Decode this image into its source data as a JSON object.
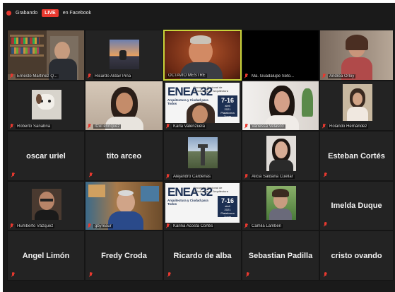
{
  "topbar": {
    "recording_label": "Grabando",
    "live_label": "LIVE",
    "platform_label": "en Facebook"
  },
  "colors": {
    "accent_active": "#c8d43a",
    "muted_mic": "#e8392f",
    "live_red": "#e8392f"
  },
  "poster": {
    "title": "ENEA 32",
    "subtitle": "Encuentro Nacional de Estudiantes de Arquitectura",
    "theme": "Arquitectura y Ciudad para Todos",
    "date_days": "7-16",
    "date_month": "abril",
    "date_year": "2021",
    "date_note": "Plataforma Zoom"
  },
  "participants": [
    {
      "name": "Ernesto Martínez Q...",
      "type": "video"
    },
    {
      "name": "Ricardo Aldair Piña",
      "type": "video"
    },
    {
      "name": "OCTAVIO MESTRE",
      "type": "video",
      "active": true
    },
    {
      "name": "Ma. Guadalupe Seto...",
      "type": "black"
    },
    {
      "name": "Andrea Orloy",
      "type": "video"
    },
    {
      "name": "Roberto Sanabria",
      "type": "video"
    },
    {
      "name": "itzel enriquez",
      "type": "video"
    },
    {
      "name": "Karla Valenzuela",
      "type": "poster"
    },
    {
      "name": "Vanessa Velasco",
      "type": "video"
    },
    {
      "name": "Rolando Hernández",
      "type": "video"
    },
    {
      "name": "oscar uriel",
      "type": "name"
    },
    {
      "name": "tito arceo",
      "type": "name"
    },
    {
      "name": "Alejandro Cárdenas",
      "type": "video"
    },
    {
      "name": "Alicia Saldaña Cuellar",
      "type": "video"
    },
    {
      "name": "Esteban Cortés",
      "type": "name"
    },
    {
      "name": "Humberto Vázquez",
      "type": "video"
    },
    {
      "name": "gbyreaur",
      "type": "video"
    },
    {
      "name": "Karina Acosta Cortés",
      "type": "poster"
    },
    {
      "name": "Camila Lamberi",
      "type": "video"
    },
    {
      "name": "Imelda Duque",
      "type": "name"
    },
    {
      "name": "Angel Limón",
      "type": "name"
    },
    {
      "name": "Fredy Croda",
      "type": "name"
    },
    {
      "name": "Ricardo de alba",
      "type": "name"
    },
    {
      "name": "Sebastian Padilla",
      "type": "name"
    },
    {
      "name": "cristo ovando",
      "type": "name"
    }
  ]
}
